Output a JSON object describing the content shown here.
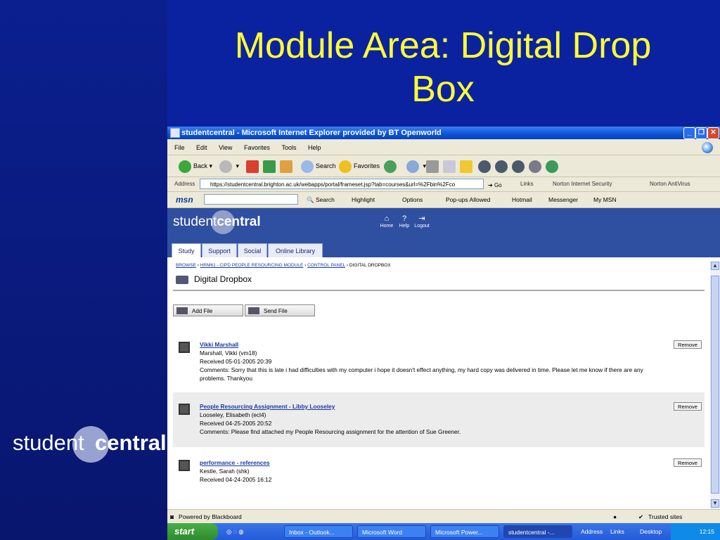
{
  "slide": {
    "title_line1": "Module Area: Digital Drop",
    "title_line2": "Box",
    "logo_left": "student",
    "logo_right": "central"
  },
  "browser": {
    "window_title": "studentcentral - Microsoft Internet Explorer provided by BT Openworld",
    "menu": [
      "File",
      "Edit",
      "View",
      "Favorites",
      "Tools",
      "Help"
    ],
    "toolbar": {
      "back": "Back",
      "search": "Search",
      "favorites": "Favorites"
    },
    "address_label": "Address",
    "url": "https://studentcentral.brighton.ac.uk/webapps/portal/frameset.jsp?tab=courses&url=%2Fbin%2Fco",
    "go": "Go",
    "links": "Links",
    "norton_security": "Norton Internet Security",
    "norton_antivirus": "Norton AntiVirus",
    "msn": {
      "logo": "msn",
      "search": "Search",
      "highlight": "Highlight",
      "options": "Options",
      "popups": "Pop-ups Allowed",
      "hotmail": "Hotmail",
      "messenger": "Messenger",
      "mymsn": "My MSN"
    },
    "status_left": "Powered by Blackboard",
    "status_right": "Trusted sites"
  },
  "site": {
    "logo_left": "student",
    "logo_right": "central",
    "topnav": [
      "Home",
      "Help",
      "Logout"
    ],
    "tabs": [
      "Study",
      "Support",
      "Social",
      "Online Library"
    ],
    "breadcrumb": [
      "BROWSE",
      "HRM61 - CIPD PEOPLE RESOURCING MODULE",
      "CONTROL PANEL",
      "DIGITAL DROPBOX"
    ],
    "page_title": "Digital Dropbox",
    "add_file": "Add File",
    "send_file": "Send File",
    "remove": "Remove",
    "items": [
      {
        "title": "Vikki Marshall",
        "name": "Marshall, Vikki (vm18)",
        "received": "Received 05-01-2005 20:39",
        "comments": "Comments: Sorry that this is late i had difficulties with my computer i hope it doesn't effect anything, my hard copy was delivered in time. Please let me know if there are any problems. Thankyou"
      },
      {
        "title": "People Resourcing Assignment - Libby Looseley",
        "name": "Looseley, Elisabeth (ecl4)",
        "received": "Received 04-25-2005 20:52",
        "comments": "Comments: Please find attached my People Resourcing assignment for the attention of Sue Greener."
      },
      {
        "title": "performance - references",
        "name": "Kestle, Sarah (shk)",
        "received": "Received 04-24-2005 16:12",
        "comments": ""
      }
    ]
  },
  "taskbar": {
    "start": "start",
    "tasks": [
      "Inbox - Outlook...",
      "Microsoft Word",
      "Microsoft Power...",
      "studentcentral -..."
    ],
    "address": "Address",
    "links": "Links",
    "desktop": "Desktop",
    "clock": "12:15"
  }
}
